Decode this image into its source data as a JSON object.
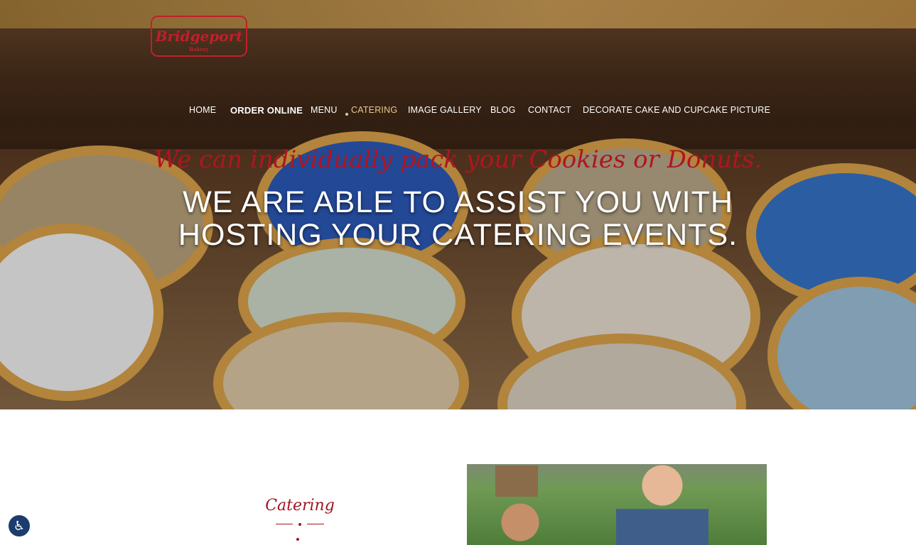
{
  "brand": {
    "logo_text": "Bridgeport",
    "logo_sub": "Bakery"
  },
  "nav": [
    {
      "label": "HOME"
    },
    {
      "label": "ORDER ONLINE"
    },
    {
      "label": "MENU"
    },
    {
      "label": "CATERING",
      "active": true
    },
    {
      "label": "IMAGE GALLERY"
    },
    {
      "label": "BLOG"
    },
    {
      "label": "CONTACT"
    },
    {
      "label": "DECORATE CAKE AND CUPCAKE PICTURE"
    }
  ],
  "hero": {
    "tagline": "We can individually pack your Cookies or Donuts.",
    "headline_line1": "WE ARE ABLE TO ASSIST YOU WITH",
    "headline_line2": "HOSTING YOUR CATERING EVENTS."
  },
  "section": {
    "title": "Catering"
  },
  "accessibility": {
    "icon": "accessibility-icon"
  },
  "colors": {
    "accent": "#a01520",
    "nav_active": "#e8c98a",
    "a11y_bg": "#1b3c6d"
  }
}
